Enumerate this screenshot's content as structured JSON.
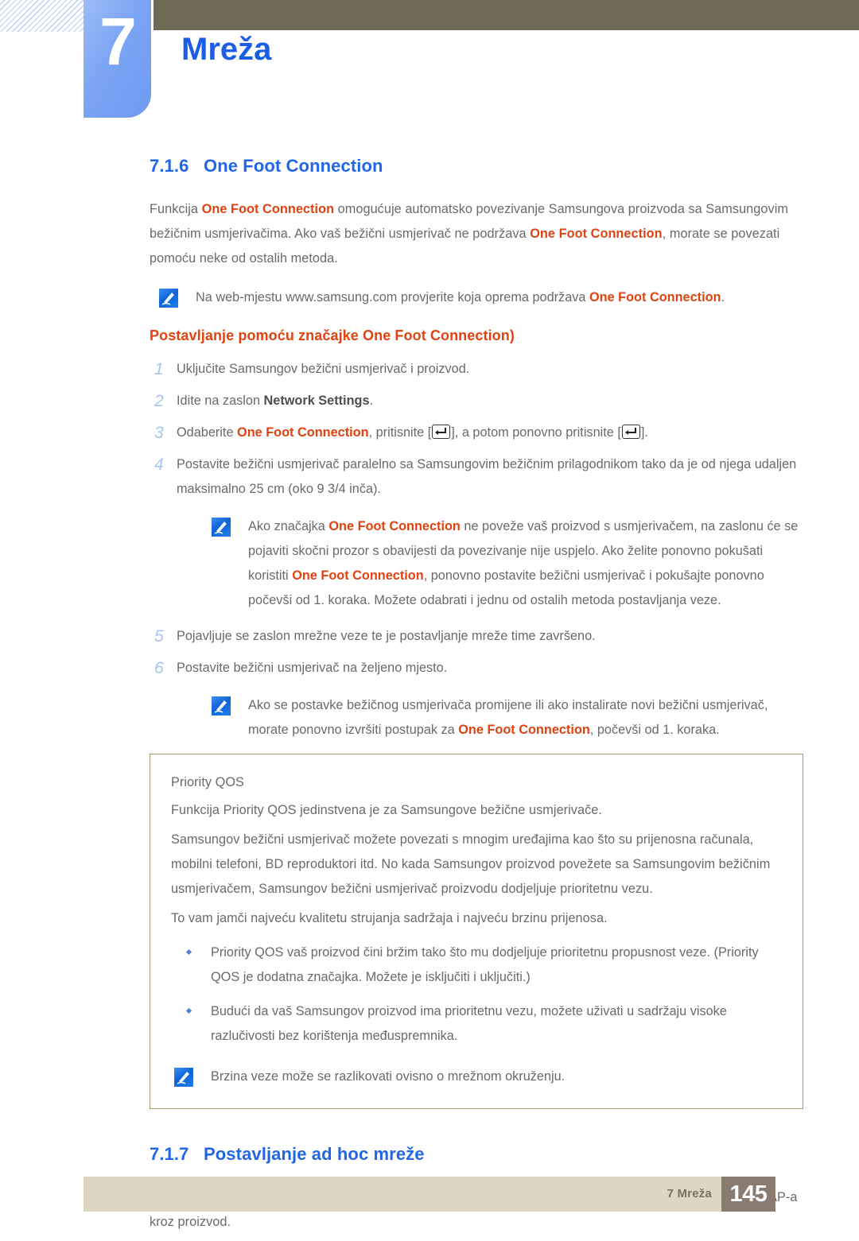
{
  "header": {
    "chapter_number": "7",
    "chapter_title": "Mreža",
    "icon_hatch": "diagonal-hatch-pattern"
  },
  "section_716": {
    "number": "7.1.6",
    "title": "One Foot Connection",
    "intro": {
      "p1_a": "Funkcija ",
      "p1_hl1": "One Foot Connection",
      "p1_b": " omogućuje automatsko povezivanje Samsungova proizvoda sa Samsungovim bežičnim usmjerivačima. Ako vaš bežični usmjerivač ne podržava ",
      "p1_hl2": "One Foot Connection",
      "p1_c": ", morate se povezati pomoću neke od ostalih metoda."
    },
    "note1": {
      "icon": "note-pencil-icon",
      "text_a": "Na web-mjestu www.samsung.com provjerite koja oprema podržava ",
      "hl": "One Foot Connection",
      "text_b": "."
    },
    "subheading": "Postavljanje pomoću značajke One Foot Connection)",
    "steps": [
      {
        "num": "1",
        "text_a": "Uključite Samsungov bežični usmjerivač i proizvod.",
        "hl": "",
        "text_b": ""
      },
      {
        "num": "2",
        "text_a": "Idite na zaslon ",
        "hl": "Network Settings",
        "text_b": "."
      },
      {
        "num": "3",
        "text_a": "Odaberite ",
        "hl": "One Foot Connection",
        "text_b": ", pritisnite [",
        "text_c": "], a potom ponovno pritisnite [",
        "text_d": "]."
      },
      {
        "num": "4",
        "text_a": "Postavite bežični usmjerivač paralelno sa Samsungovim bežičnim prilagodnikom tako da je od njega udaljen maksimalno 25 cm (oko 9 3/4 inča).",
        "hl": "",
        "text_b": ""
      },
      {
        "num": "5",
        "text_a": "Pojavljuje se zaslon mrežne veze te je postavljanje mreže time završeno.",
        "hl": "",
        "text_b": ""
      },
      {
        "num": "6",
        "text_a": "Postavite bežični usmjerivač na željeno mjesto.",
        "hl": "",
        "text_b": ""
      }
    ],
    "note2": {
      "icon": "note-pencil-icon",
      "text_a": "Ako značajka ",
      "hl1": "One Foot Connection",
      "text_b": " ne poveže vaš proizvod s usmjerivačem, na zaslonu će se pojaviti skočni prozor s obavijesti da povezivanje nije uspjelo. Ako želite ponovno pokušati koristiti ",
      "hl2": "One Foot Connection",
      "text_c": ", ponovno postavite bežični usmjerivač i pokušajte ponovno počevši od 1. koraka. Možete odabrati i jednu od ostalih metoda postavljanja veze."
    },
    "note3": {
      "icon": "note-pencil-icon",
      "text_a": "Ako se postavke bežičnog usmjerivača promijene ili ako instalirate novi bežični usmjerivač, morate ponovno izvršiti postupak za ",
      "hl": "One Foot Connection",
      "text_b": ", počevši od 1. koraka."
    }
  },
  "qos_box": {
    "title": "Priority QOS",
    "paragraphs": [
      "Funkcija Priority QOS jedinstvena je za Samsungove bežične usmjerivače.",
      "Samsungov bežični usmjerivač možete povezati s mnogim uređajima kao što su prijenosna računala, mobilni telefoni, BD reproduktori itd. No kada Samsungov proizvod povežete sa Samsungovim bežičnim usmjerivačem, Samsungov bežični usmjerivač proizvodu dodjeljuje prioritetnu vezu.",
      "To vam jamči najveću kvalitetu strujanja sadržaja i najveću brzinu prijenosa."
    ],
    "bullets": [
      "Priority QOS vaš proizvod čini bržim tako što mu dodjeljuje prioritetnu propusnost veze. (Priority QOS je dodatna značajka. Možete je isključiti i uključiti.)",
      "Budući da vaš Samsungov proizvod ima prioritetnu vezu, možete uživati u sadržaju visoke razlučivosti bez korištenja međuspremnika."
    ],
    "note": {
      "icon": "note-pencil-icon",
      "text": "Brzina veze može se razlikovati ovisno o mrežnom okruženju."
    }
  },
  "section_717": {
    "number": "7.1.7",
    "title": "Postavljanje ad hoc mreže",
    "paragraph": "Možete se povezati s mobilnim uređajem koji podržava ad hoc veze bez korištenja bežičnog usmjerivača ili AP-a kroz proizvod."
  },
  "footer": {
    "label": "7 Mreža",
    "page_number": "145"
  },
  "colors": {
    "accent_blue": "#2266e8",
    "highlight_orange": "#e1420f",
    "body_gray": "#6a6a6a",
    "olive_bar": "#6e6a56",
    "footer_bar": "#ddd6c2",
    "footer_page_box": "#8a7b71",
    "box_border": "#a89a6e",
    "step_number_blue": "#a8c4f2"
  }
}
